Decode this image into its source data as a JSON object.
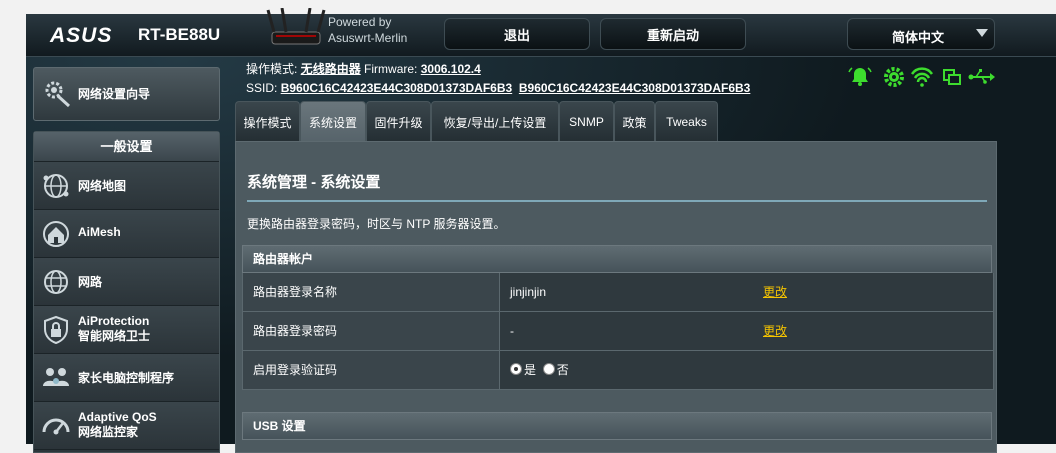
{
  "header": {
    "brand": "ASUS",
    "model": "RT-BE88U",
    "powered_by_line1": "Powered by",
    "powered_by_line2": "Asuswrt-Merlin",
    "logout_label": "退出",
    "reboot_label": "重新启动",
    "language": "简体中文"
  },
  "quick_setup": {
    "label": "网络设置向导",
    "icon": "gear-wand-icon"
  },
  "sidebar": {
    "section_title": "一般设置",
    "items": [
      {
        "label": "网络地图",
        "icon": "globe-network-icon"
      },
      {
        "label": "AiMesh",
        "icon": "mesh-house-icon"
      },
      {
        "label": "网路",
        "icon": "globe-icon"
      },
      {
        "label": "AiProtection",
        "label2": "智能网络卫士",
        "icon": "shield-lock-icon"
      },
      {
        "label": "家长电脑控制程序",
        "icon": "family-icon"
      },
      {
        "label": "Adaptive QoS",
        "label2": "网络监控家",
        "icon": "gauge-icon"
      }
    ]
  },
  "info": {
    "mode_label": "操作模式:",
    "mode_value": "无线路由器",
    "firmware_label": "Firmware:",
    "firmware_value": "3006.102.4",
    "ssid_label": "SSID:",
    "ssid_1": "B960C16C42423E44C308D01373DAF6B3",
    "ssid_2": "B960C16C42423E44C308D01373DAF6B3"
  },
  "status_icons": [
    "bell-icon",
    "settings-gear-icon",
    "wifi-icon",
    "devices-icon",
    "usb-icon"
  ],
  "accent_colors": {
    "status_green": "#3ddc2e",
    "link_yellow": "#f5c400",
    "divider_blue": "#7fa8b8"
  },
  "tabs": [
    {
      "label": "操作模式"
    },
    {
      "label": "系统设置"
    },
    {
      "label": "固件升级"
    },
    {
      "label": "恢复/导出/上传设置"
    },
    {
      "label": "SNMP"
    },
    {
      "label": "政策"
    },
    {
      "label": "Tweaks"
    }
  ],
  "active_tab": "系统设置",
  "page": {
    "title": "系统管理 - 系统设置",
    "description": "更换路由器登录密码，时区与 NTP 服务器设置。"
  },
  "router_account": {
    "section_title": "路由器帐户",
    "rows": [
      {
        "label": "路由器登录名称",
        "value": "jinjinjin",
        "action": "更改"
      },
      {
        "label": "路由器登录密码",
        "value": "-",
        "action": "更改"
      }
    ],
    "captcha": {
      "label": "启用登录验证码",
      "option_yes": "是",
      "option_no": "否",
      "selected": "是"
    }
  },
  "usb_section": {
    "section_title": "USB 设置"
  }
}
